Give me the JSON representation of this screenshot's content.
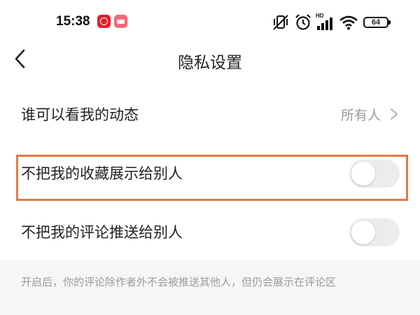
{
  "status_bar": {
    "time": "15:38",
    "battery": "64",
    "network_label": "HD",
    "notification_icons": [
      "netease-music-icon",
      "shopping-app-icon"
    ],
    "system_icons": [
      "mute-vibrate-icon",
      "alarm-icon",
      "cell-signal-icon",
      "wifi-icon",
      "battery-icon"
    ]
  },
  "header": {
    "title": "隐私设置",
    "back_icon": "chevron-left-icon"
  },
  "settings": [
    {
      "label": "谁可以看我的动态",
      "value": "所有人",
      "control": "chevron-right-icon"
    },
    {
      "label": "不把我的收藏展示给别人",
      "control": "toggle",
      "enabled": false,
      "highlighted": true
    },
    {
      "label": "不把我的评论推送给别人",
      "control": "toggle",
      "enabled": false
    }
  ],
  "footer": {
    "note": "开启后，你的评论除作者外不会被推送其他人，但仍会展示在评论区"
  },
  "colors": {
    "highlight_border": "#e27a45",
    "toggle_off": "#ececec",
    "secondary_text": "#9a9a9a",
    "footer_bg": "#f6f6f6"
  }
}
